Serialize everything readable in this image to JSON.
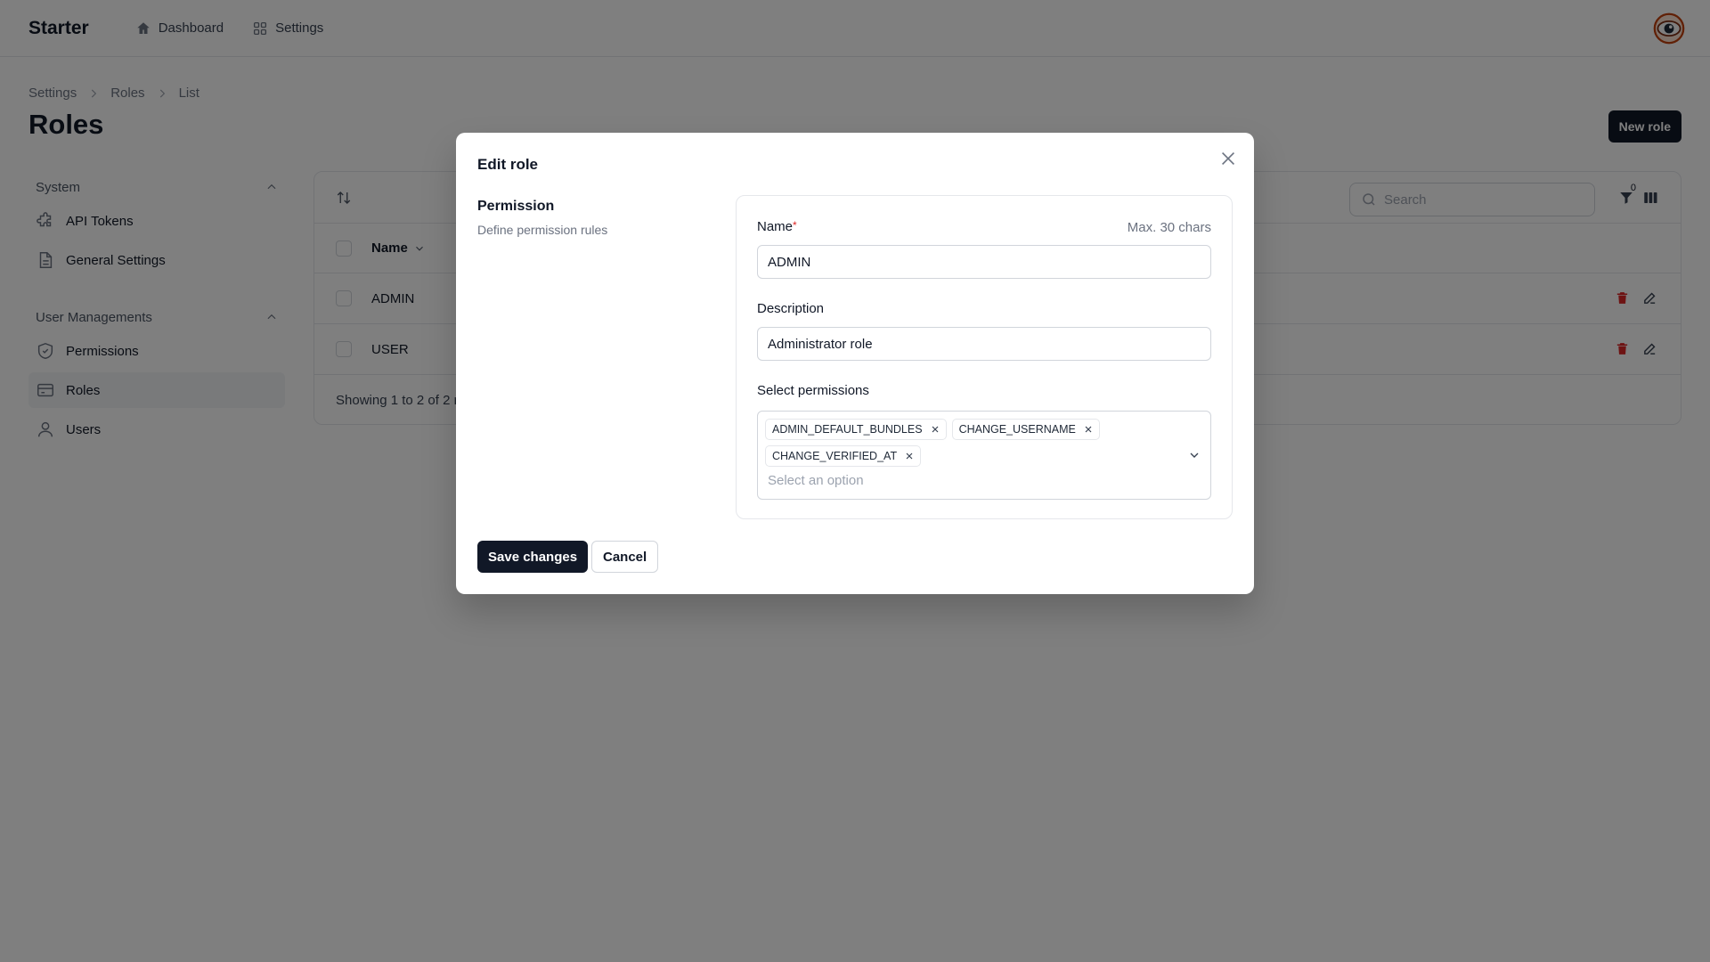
{
  "app": {
    "brand": "Starter",
    "nav": [
      {
        "label": "Dashboard",
        "icon": "home-icon"
      },
      {
        "label": "Settings",
        "icon": "grid-icon"
      }
    ]
  },
  "breadcrumb": [
    "Settings",
    "Roles",
    "List"
  ],
  "page": {
    "title": "Roles",
    "new_button": "New role"
  },
  "sidebar": {
    "groups": [
      {
        "title": "System",
        "items": [
          {
            "label": "API Tokens",
            "icon": "puzzle-icon"
          },
          {
            "label": "General Settings",
            "icon": "document-icon"
          }
        ]
      },
      {
        "title": "User Managements",
        "items": [
          {
            "label": "Permissions",
            "icon": "shield-icon"
          },
          {
            "label": "Roles",
            "icon": "card-icon",
            "active": true
          },
          {
            "label": "Users",
            "icon": "user-icon"
          }
        ]
      }
    ]
  },
  "table": {
    "search_placeholder": "Search",
    "filter_count": "0",
    "columns": [
      "Name"
    ],
    "rows": [
      "ADMIN",
      "USER"
    ],
    "footer": "Showing 1 to 2 of 2 r"
  },
  "modal": {
    "title": "Edit role",
    "section_title": "Permission",
    "section_desc": "Define permission rules",
    "name_label": "Name",
    "name_hint": "Max. 30 chars",
    "name_value": "ADMIN",
    "description_label": "Description",
    "description_value": "Administrator role",
    "permissions_label": "Select permissions",
    "permissions": [
      "ADMIN_DEFAULT_BUNDLES",
      "CHANGE_USERNAME",
      "CHANGE_VERIFIED_AT"
    ],
    "permissions_placeholder": "Select an option",
    "save_label": "Save changes",
    "cancel_label": "Cancel"
  },
  "colors": {
    "primary_button": "#111827",
    "required_marker": "#dc2626",
    "delete_action": "#dc2626",
    "overlay": "rgba(0,0,0,0.5)"
  }
}
